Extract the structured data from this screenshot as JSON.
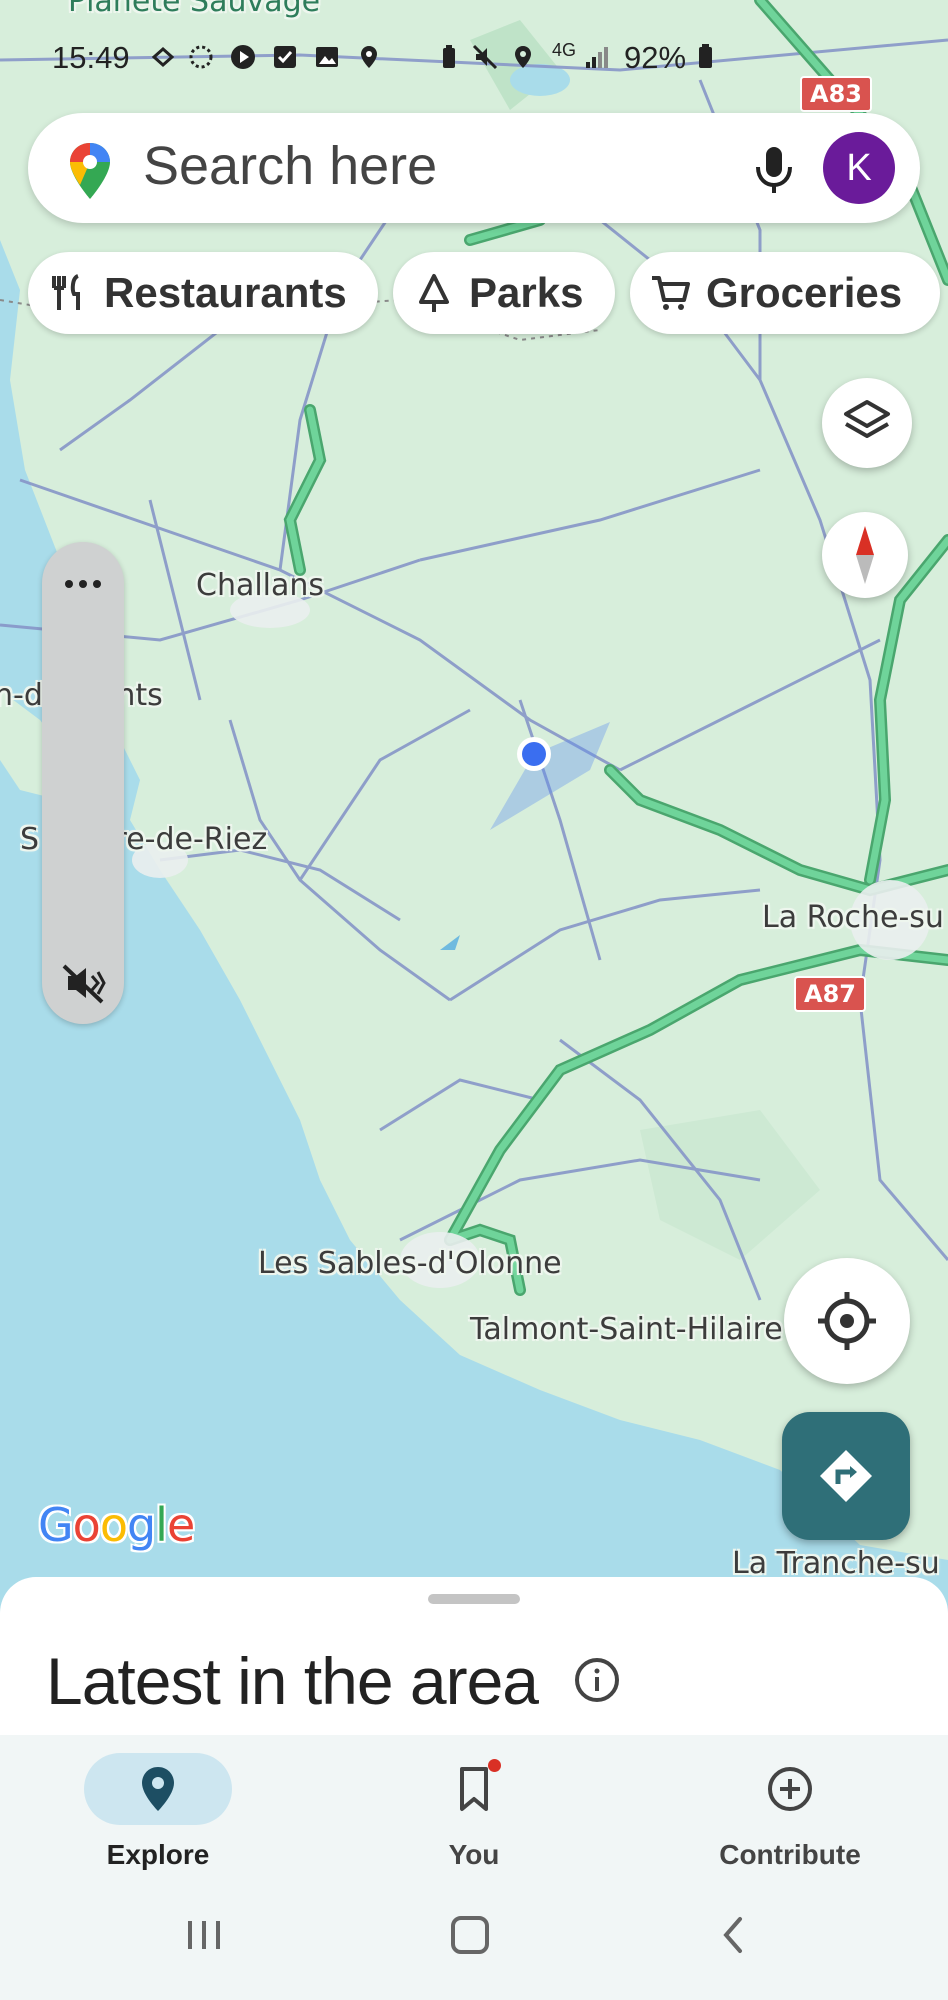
{
  "status_bar": {
    "time": "15:49",
    "battery": "92%",
    "network": "4G"
  },
  "map": {
    "labels": {
      "planete": "Planète Sauvage",
      "challans": "Challans",
      "monts": "n-de-Monts",
      "hilaire_riez": "S   Hilaire-de-Riez",
      "la_roche": "La Roche-su",
      "sables": "Les Sables-d'Olonne",
      "talmont": "Talmont-Saint-Hilaire",
      "tranche": "La Tranche-su"
    },
    "shields": {
      "a83": "A83",
      "a87": "A87"
    },
    "google_logo": "Google"
  },
  "search": {
    "placeholder": "Search here",
    "avatar_initial": "K"
  },
  "chips": [
    {
      "label": "Restaurants",
      "icon": "fork-knife-icon"
    },
    {
      "label": "Parks",
      "icon": "tree-icon"
    },
    {
      "label": "Groceries",
      "icon": "cart-icon"
    }
  ],
  "sheet": {
    "title": "Latest in the area"
  },
  "nav": [
    {
      "label": "Explore",
      "icon": "location-pin-icon",
      "active": true
    },
    {
      "label": "You",
      "icon": "bookmark-icon",
      "active": false
    },
    {
      "label": "Contribute",
      "icon": "add-circle-icon",
      "active": false
    }
  ],
  "colors": {
    "land": "#d7eedb",
    "water": "#a9dcea",
    "highway": "#5cc387",
    "accent_blue": "#3a6ef0",
    "directions": "#2f6f78",
    "avatar": "#6a1b9a",
    "nav_active_pill": "#cde6f0"
  }
}
